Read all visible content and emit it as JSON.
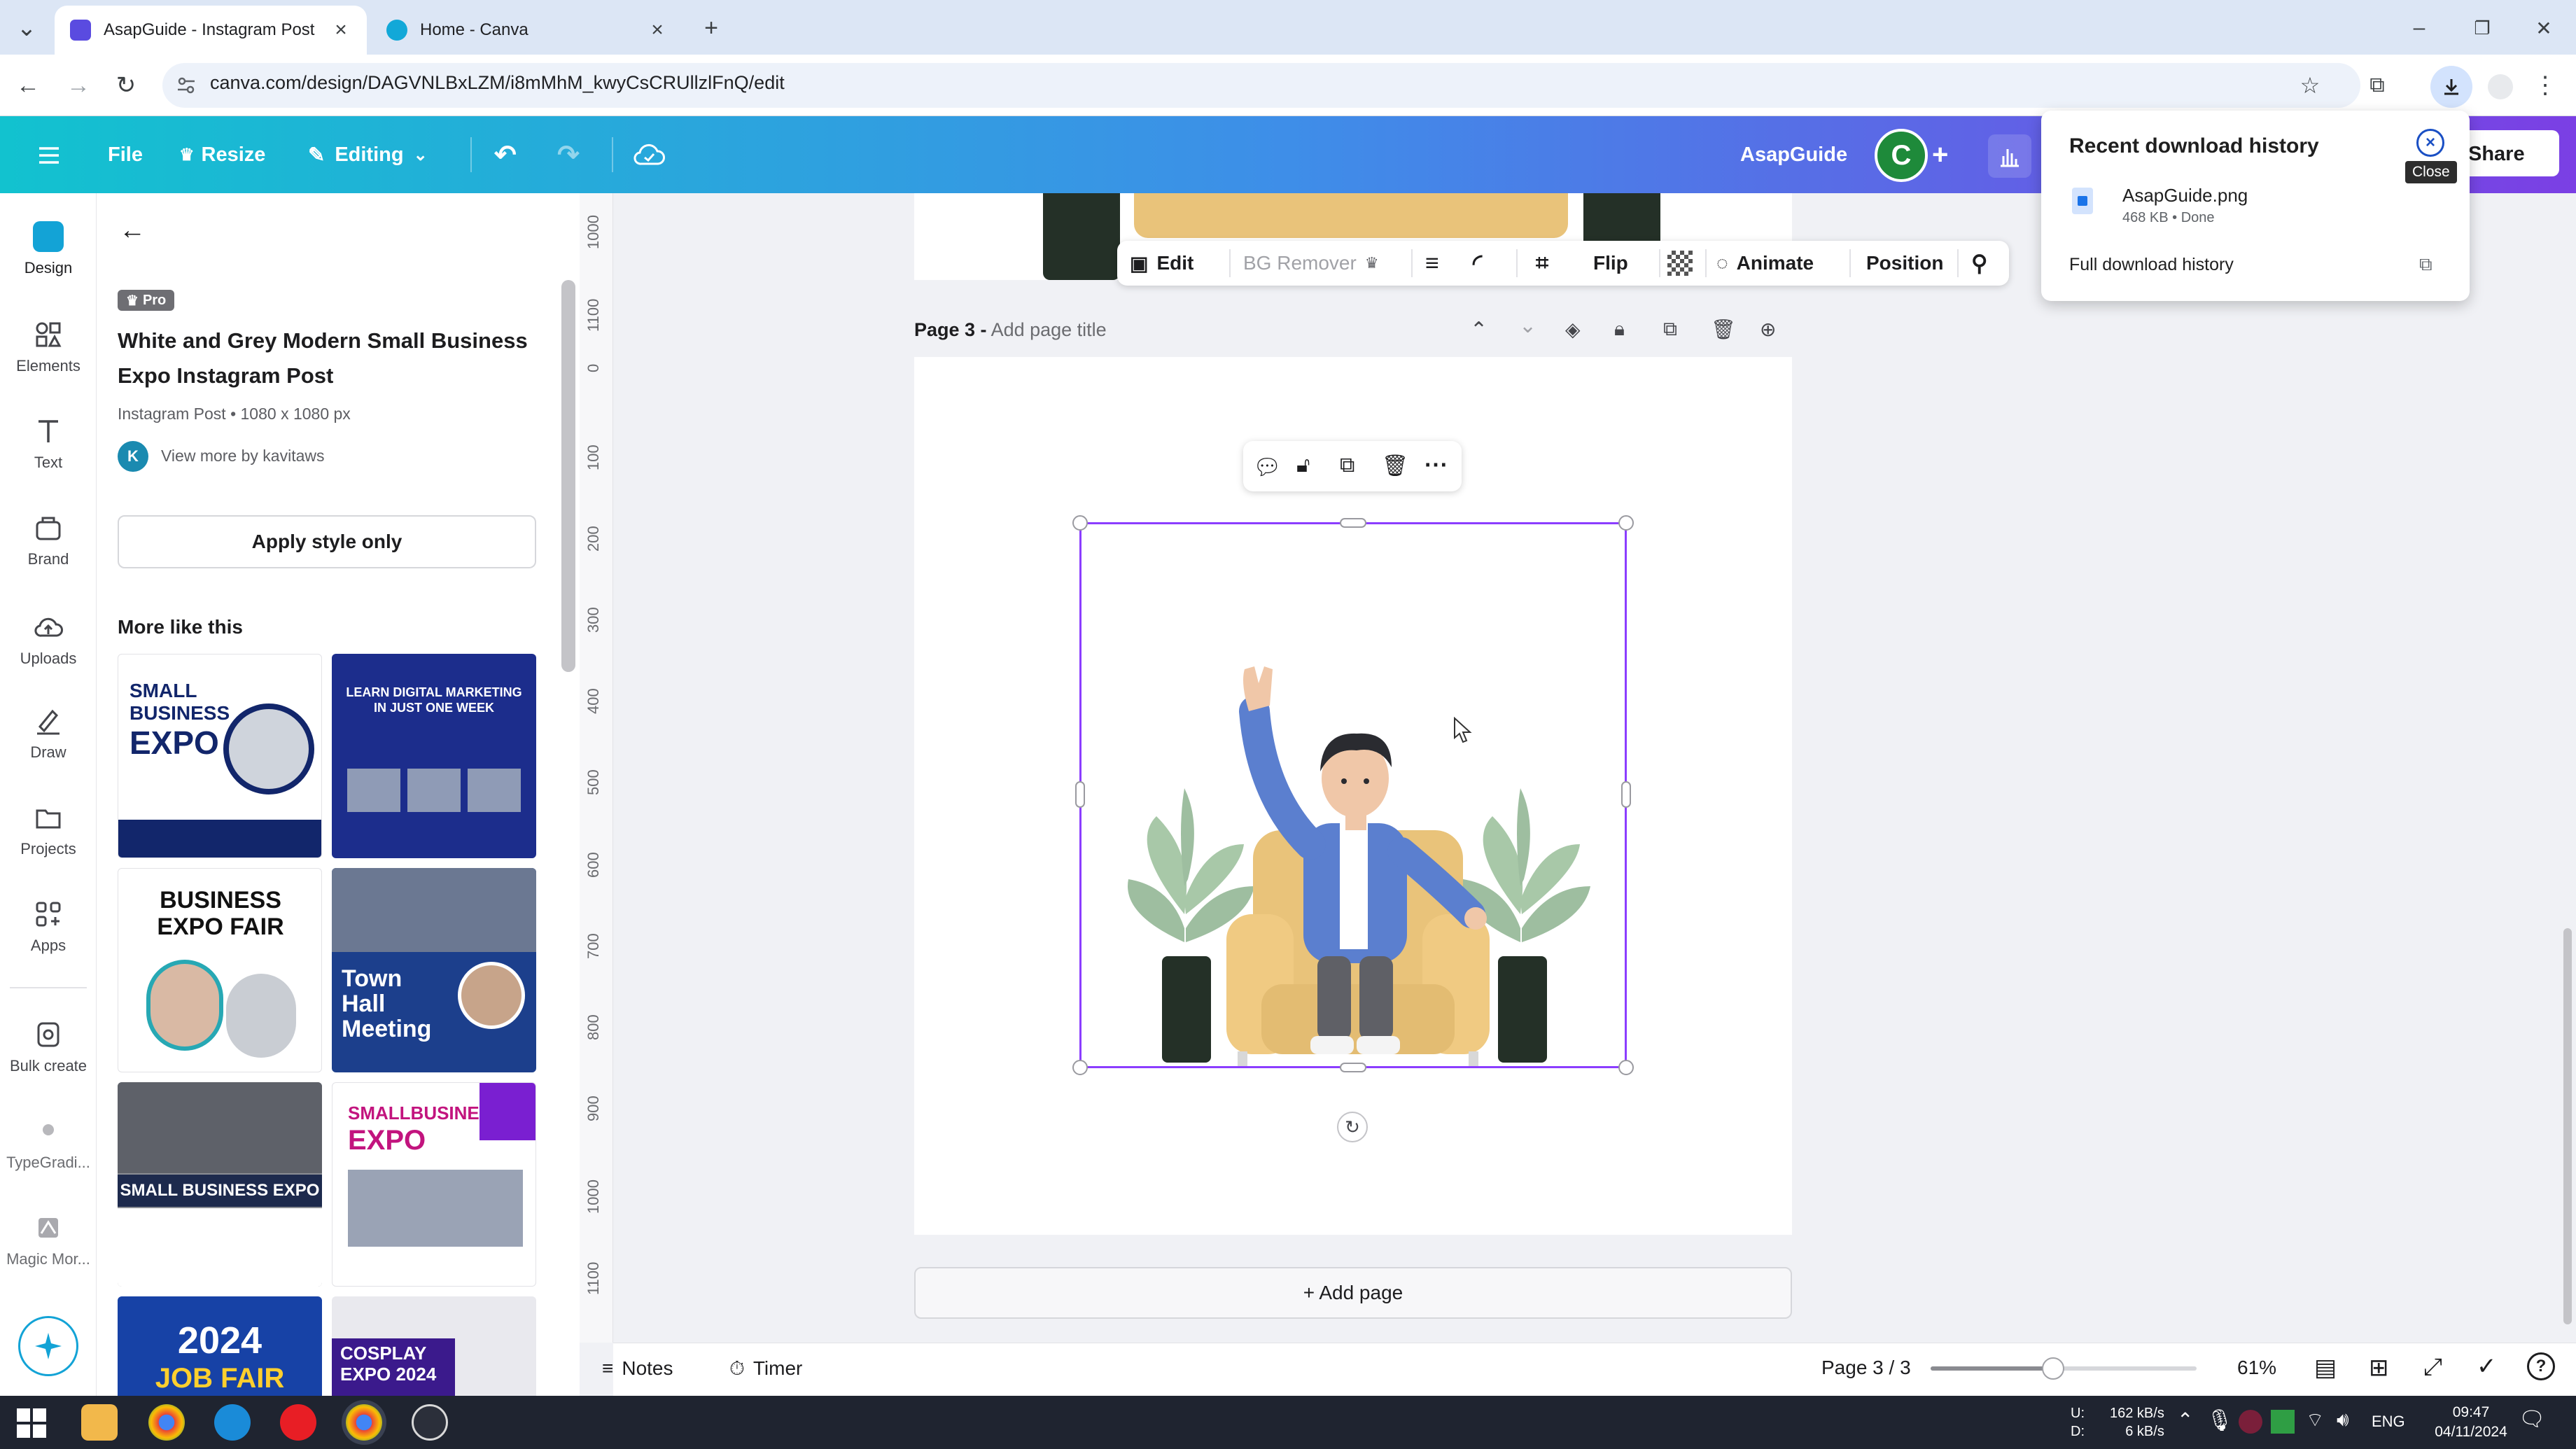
{
  "browser": {
    "tabs": [
      {
        "title": "AsapGuide - Instagram Post",
        "active": true
      },
      {
        "title": "Home - Canva",
        "active": false
      }
    ],
    "new_tab": "+",
    "url": "canva.com/design/DAGVNLBxLZM/i8mMhM_kwyCsCRUllzlFnQ/edit",
    "window_controls": [
      "–",
      "❐",
      "✕"
    ]
  },
  "canva_bar": {
    "file": "File",
    "resize": "Resize",
    "editing": "Editing",
    "workspace": "AsapGuide",
    "avatar": "C",
    "share": "Share"
  },
  "side_rail": [
    {
      "label": "Design",
      "icon": "design-icon"
    },
    {
      "label": "Elements",
      "icon": "elements-icon"
    },
    {
      "label": "Text",
      "icon": "text-icon"
    },
    {
      "label": "Brand",
      "icon": "brand-icon"
    },
    {
      "label": "Uploads",
      "icon": "uploads-icon"
    },
    {
      "label": "Draw",
      "icon": "draw-icon"
    },
    {
      "label": "Projects",
      "icon": "projects-icon"
    },
    {
      "label": "Apps",
      "icon": "apps-icon"
    },
    {
      "label": "Bulk create",
      "icon": "bulk-create-icon"
    },
    {
      "label": "TypeGradi...",
      "icon": "typegradient-icon"
    },
    {
      "label": "Magic Mor...",
      "icon": "magic-morph-icon"
    }
  ],
  "panel": {
    "badge": "Pro",
    "title": "White and Grey Modern Small Business Expo Instagram Post",
    "meta": "Instagram Post • 1080 x 1080 px",
    "author_initial": "K",
    "author_link": "View more by kavitaws",
    "apply_button": "Apply style only",
    "more_heading": "More like this",
    "templates": [
      {
        "line1": "SMALL",
        "line2": "BUSINESS",
        "line3": "EXPO"
      },
      {
        "line1": "LEARN DIGITAL MARKETING",
        "line2": "IN JUST ONE WEEK",
        "line3": ""
      },
      {
        "line1": "BUSINESS",
        "line2": "EXPO FAIR",
        "line3": ""
      },
      {
        "line1": "Town",
        "line2": "Hall",
        "line3": "Meeting"
      },
      {
        "line1": "SMALL BUSINESS EXPO",
        "line2": "",
        "line3": ""
      },
      {
        "line1": "SMALLBUSINESS",
        "line2": "EXPO",
        "line3": ""
      },
      {
        "line1": "2024",
        "line2": "JOB FAIR",
        "line3": ""
      },
      {
        "line1": "COSPLAY",
        "line2": "EXPO 2024",
        "line3": ""
      }
    ]
  },
  "ruler_marks": [
    "1000",
    "1100",
    "0",
    "100",
    "200",
    "300",
    "400",
    "500",
    "600",
    "700",
    "800",
    "900",
    "1000",
    "1100"
  ],
  "toolbar": {
    "edit": "Edit",
    "bg_remover": "BG Remover",
    "flip": "Flip",
    "animate": "Animate",
    "position": "Position"
  },
  "page3": {
    "label": "Page 3 -",
    "placeholder": "Add page title"
  },
  "add_page": "+ Add page",
  "download_popup": {
    "title": "Recent download history",
    "close_tooltip": "Close",
    "file_name": "AsapGuide.png",
    "file_meta": "468 KB • Done",
    "full_history": "Full download history"
  },
  "bottom_bar": {
    "notes": "Notes",
    "timer": "Timer",
    "page_indicator": "Page 3 / 3",
    "zoom_fraction": 0.46,
    "zoom_label": "61%"
  },
  "taskbar": {
    "net_up": "162 kB/s",
    "net_down": "6 kB/s",
    "net_up_label": "U:",
    "net_down_label": "D:",
    "lang": "ENG",
    "time": "09:47",
    "date": "04/11/2024"
  },
  "colors": {
    "accent_purple": "#8b3dff",
    "canva_teal": "#13c1d0",
    "selection": "#8b3dff",
    "avatar_green": "#1e8a3a"
  }
}
